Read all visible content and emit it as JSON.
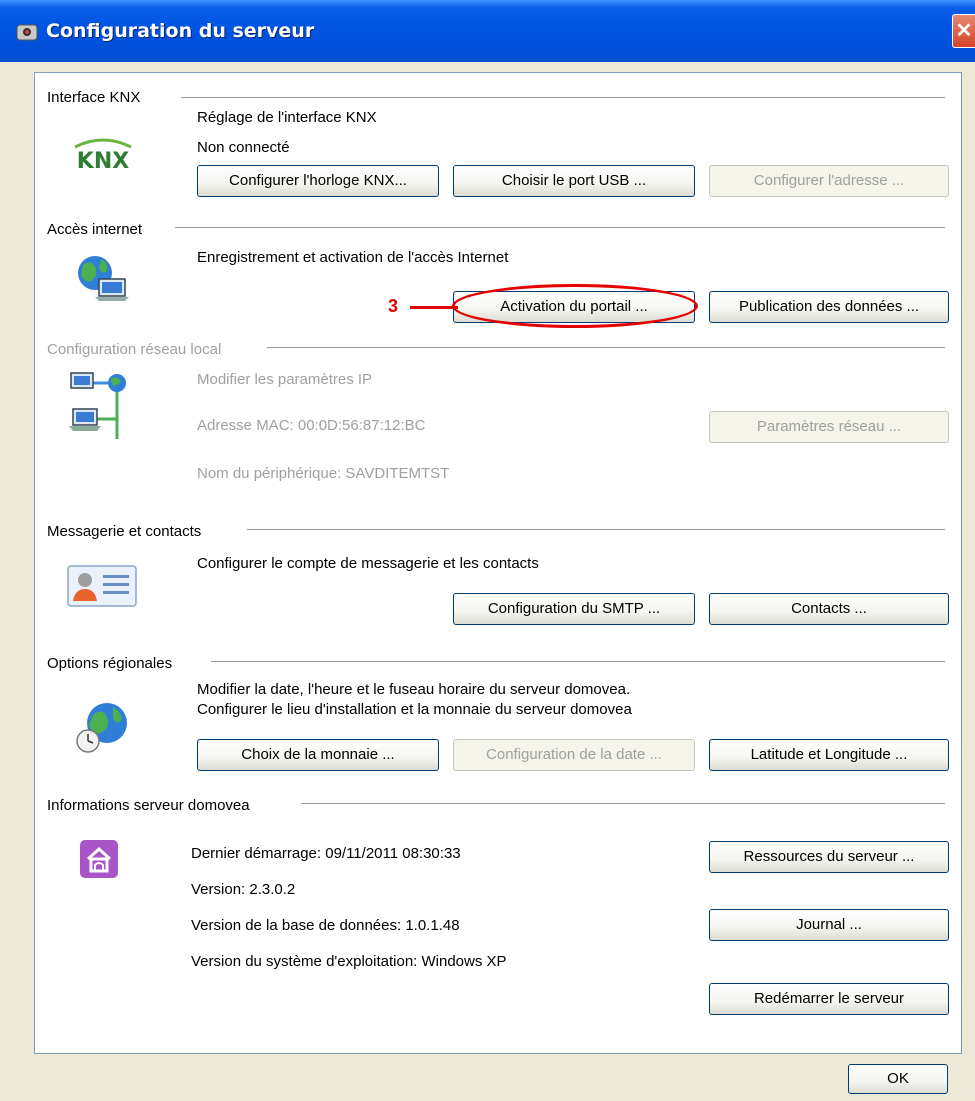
{
  "window": {
    "title": "Configuration du serveur",
    "close_glyph": "✕"
  },
  "colors": {
    "accent_annotation": "#E50000",
    "titlebar": "#0054E3"
  },
  "sections": {
    "knx": {
      "title": "Interface KNX",
      "logo_text": "KNX",
      "line1": "Réglage de l'interface KNX",
      "line2": "Non connecté",
      "buttons": [
        "Configurer l'horloge KNX...",
        "Choisir le port USB ...",
        "Configurer l'adresse ..."
      ]
    },
    "internet": {
      "title": "Accès internet",
      "line1": "Enregistrement et activation de l'accès Internet",
      "buttons": [
        "Activation du portail ...",
        "Publication des données ..."
      ],
      "annotation": "3"
    },
    "network": {
      "title": "Configuration réseau local",
      "line1": "Modifier les paramètres IP",
      "line2": "Adresse MAC: 00:0D:56:87:12:BC",
      "line3": "Nom du périphérique: SAVDITEMTST",
      "buttons": [
        "Paramètres réseau ..."
      ]
    },
    "mail": {
      "title": "Messagerie et contacts",
      "line1": "Configurer le compte de messagerie et les contacts",
      "buttons": [
        "Configuration du SMTP ...",
        "Contacts ..."
      ]
    },
    "regional": {
      "title": "Options régionales",
      "line1": "Modifier la date, l'heure et le fuseau horaire du serveur domovea.",
      "line2": "Configurer le lieu d'installation et la monnaie du serveur domovea",
      "buttons": [
        "Choix de la monnaie ...",
        "Configuration de la date ...",
        "Latitude et Longitude ..."
      ]
    },
    "info": {
      "title": "Informations serveur domovea",
      "line1": "Dernier démarrage: 09/11/2011 08:30:33",
      "line2": "Version: 2.3.0.2",
      "line3": "Version de la base de données: 1.0.1.48",
      "line4": "Version du système d'exploitation: Windows XP",
      "buttons": [
        "Ressources du serveur ...",
        "Journal ...",
        "Redémarrer le serveur"
      ]
    }
  },
  "footer": {
    "ok_label": "OK"
  },
  "icons": [
    "knx-logo-icon",
    "globe-computer-icon",
    "network-computers-icon",
    "contact-card-icon",
    "globe-clock-icon",
    "house-icon"
  ]
}
